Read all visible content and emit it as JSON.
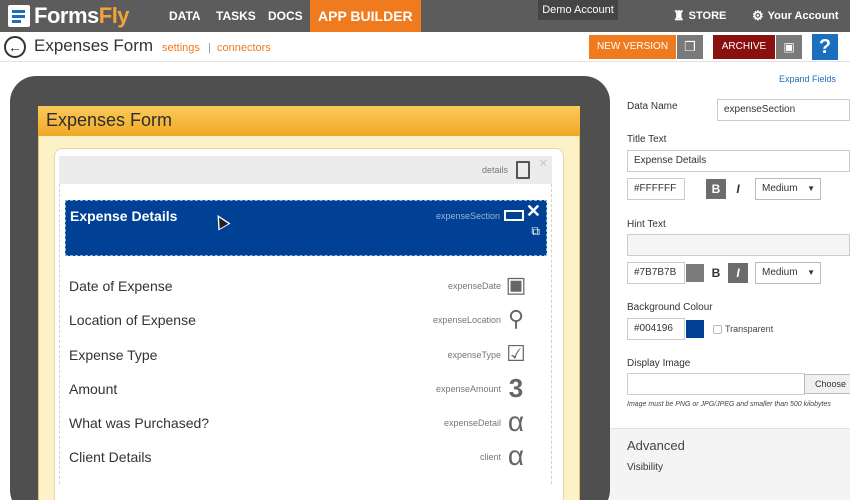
{
  "app": {
    "logo": "Forms",
    "logo_accent": "Fly"
  },
  "nav": {
    "items": [
      "DATA",
      "TASKS",
      "DOCS"
    ],
    "active": "APP BUILDER"
  },
  "demo_badge": "Demo Account",
  "top_right": {
    "store": "STORE",
    "account": "Your Account"
  },
  "header": {
    "title": "Expenses Form",
    "settings_link": "settings",
    "connectors_link": "connectors",
    "separator": "|",
    "new_version_label": "NEW VERSION",
    "archive_label": "ARCHIVE",
    "help_label": "?"
  },
  "form": {
    "title": "Expenses Form",
    "details_key": "details",
    "section": {
      "title": "Expense Details",
      "key": "expenseSection"
    },
    "fields": [
      {
        "label": "Date of Expense",
        "key": "expenseDate",
        "icon": "calendar-icon"
      },
      {
        "label": "Location of Expense",
        "key": "expenseLocation",
        "icon": "location-pin-icon"
      },
      {
        "label": "Expense Type",
        "key": "expenseType",
        "icon": "checkbox-icon"
      },
      {
        "label": "Amount",
        "key": "expenseAmount",
        "icon": "number-icon"
      },
      {
        "label": "What was Purchased?",
        "key": "expenseDetail",
        "icon": "text-icon"
      },
      {
        "label": "Client Details",
        "key": "client",
        "icon": "text-icon"
      }
    ]
  },
  "properties": {
    "expand_link": "Expand Fields",
    "data_name_label": "Data Name",
    "data_name_value": "expenseSection",
    "title_text_label": "Title Text",
    "title_text_value": "Expense Details",
    "title_color": "#FFFFFF",
    "title_bold": "B",
    "title_italic": "I",
    "title_size": "Medium",
    "hint_text_label": "Hint Text",
    "hint_text_value": "",
    "hint_color": "#7B7B7B",
    "hint_bold": "B",
    "hint_italic": "I",
    "hint_size": "Medium",
    "bg_label": "Background Colour",
    "bg_color": "#004196",
    "transparent_label": "Transparent",
    "display_image_label": "Display Image",
    "display_image_value": "",
    "choose_label": "Choose",
    "image_note": "Image must be PNG or JPG/JPEG and smaller than 500 kilobytes",
    "advanced_label": "Advanced",
    "visibility_label": "Visibility"
  },
  "colors": {
    "accent": "#f07a1e",
    "section": "#004196",
    "archive": "#8a1010",
    "help": "#1c6fbf",
    "hint_swatch": "#7B7B7B"
  }
}
